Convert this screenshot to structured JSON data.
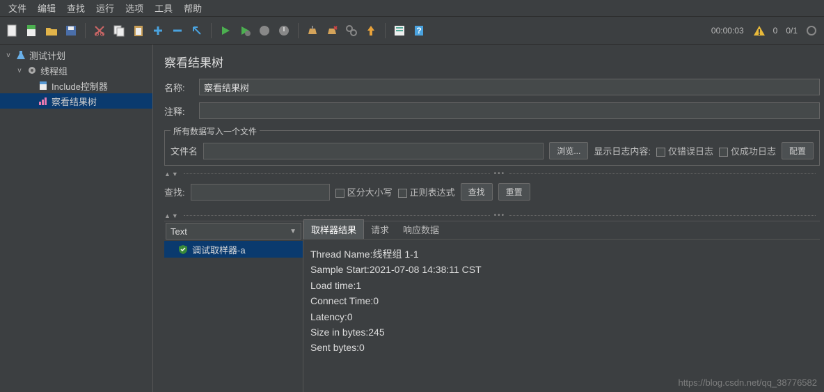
{
  "menu": {
    "items": [
      "文件",
      "编辑",
      "查找",
      "运行",
      "选项",
      "工具",
      "帮助"
    ]
  },
  "toolbar": {
    "timer": "00:00:03",
    "count_left": "0",
    "count_right": "0/1"
  },
  "tree": {
    "items": [
      {
        "label": "测试计划",
        "icon": "flask",
        "expanded": true,
        "indent": 1
      },
      {
        "label": "线程组",
        "icon": "gear",
        "expanded": true,
        "indent": 2
      },
      {
        "label": "Include控制器",
        "icon": "doc",
        "indent": 3
      },
      {
        "label": "察看结果树",
        "icon": "chart",
        "indent": 3,
        "selected": true
      }
    ]
  },
  "panel": {
    "title": "察看结果树",
    "name_label": "名称:",
    "name_value": "察看结果树",
    "comment_label": "注释:",
    "comment_value": "",
    "fileGroup": {
      "legend": "所有数据写入一个文件",
      "filename_label": "文件名",
      "filename_value": "",
      "browse": "浏览...",
      "showlog_label": "显示日志内容:",
      "only_error": "仅错误日志",
      "only_success": "仅成功日志",
      "config": "配置"
    },
    "search": {
      "label": "查找:",
      "value": "",
      "case_sensitive": "区分大小写",
      "regex": "正则表达式",
      "find_btn": "查找",
      "reset_btn": "重置"
    },
    "combo_value": "Text",
    "tabs": [
      "取样器结果",
      "请求",
      "响应数据"
    ],
    "sample_name": "调试取样器-a",
    "chart_data": {
      "type": "table",
      "rows": [
        {
          "key": "Thread Name",
          "value": "线程组 1-1"
        },
        {
          "key": "Sample Start",
          "value": "2021-07-08 14:38:11 CST"
        },
        {
          "key": "Load time",
          "value": "1"
        },
        {
          "key": "Connect Time",
          "value": "0"
        },
        {
          "key": "Latency",
          "value": "0"
        },
        {
          "key": "Size in bytes",
          "value": "245"
        },
        {
          "key": "Sent bytes",
          "value": "0"
        }
      ]
    },
    "detail_lines": [
      "Thread Name:线程组 1-1",
      "Sample Start:2021-07-08 14:38:11 CST",
      "Load time:1",
      "Connect Time:0",
      "Latency:0",
      "Size in bytes:245",
      "Sent bytes:0"
    ]
  },
  "watermark": "https://blog.csdn.net/qq_38776582"
}
